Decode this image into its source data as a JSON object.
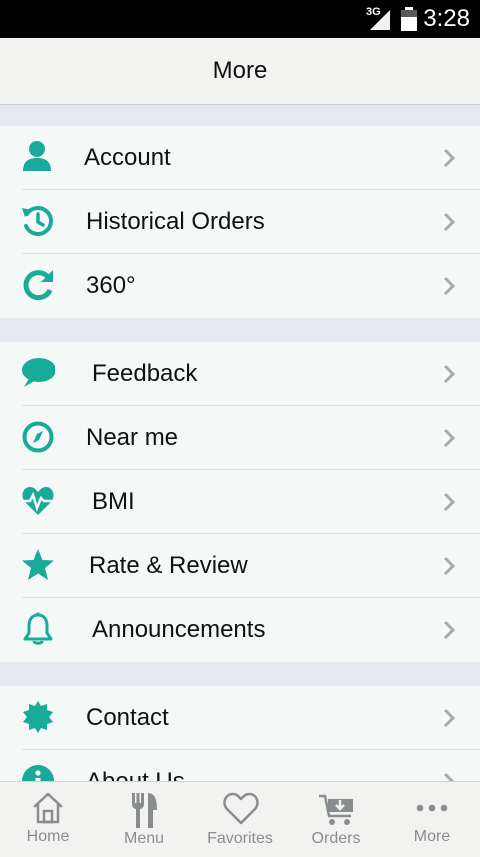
{
  "status_bar": {
    "time": "3:28",
    "network": "3G"
  },
  "header": {
    "title": "More"
  },
  "groups": [
    {
      "items": [
        {
          "label": "Account",
          "icon": "person-icon"
        },
        {
          "label": "Historical Orders",
          "icon": "history-icon"
        },
        {
          "label": "360°",
          "icon": "refresh-icon"
        }
      ]
    },
    {
      "items": [
        {
          "label": "Feedback",
          "icon": "chat-bubble-icon"
        },
        {
          "label": "Near me",
          "icon": "compass-icon"
        },
        {
          "label": "BMI",
          "icon": "heartbeat-icon"
        },
        {
          "label": "Rate & Review",
          "icon": "star-icon"
        },
        {
          "label": "Announcements",
          "icon": "bell-icon"
        }
      ]
    },
    {
      "items": [
        {
          "label": "Contact",
          "icon": "badge-icon"
        },
        {
          "label": "About Us",
          "icon": "info-icon"
        }
      ]
    }
  ],
  "tabs": [
    {
      "label": "Home",
      "icon": "home-icon"
    },
    {
      "label": "Menu",
      "icon": "fork-knife-icon"
    },
    {
      "label": "Favorites",
      "icon": "heart-icon"
    },
    {
      "label": "Orders",
      "icon": "cart-icon"
    },
    {
      "label": "More",
      "icon": "more-dots-icon"
    }
  ],
  "colors": {
    "accent": "#1aaa9a",
    "tab_gray": "#8a8d90",
    "chevron": "#a7abad"
  }
}
